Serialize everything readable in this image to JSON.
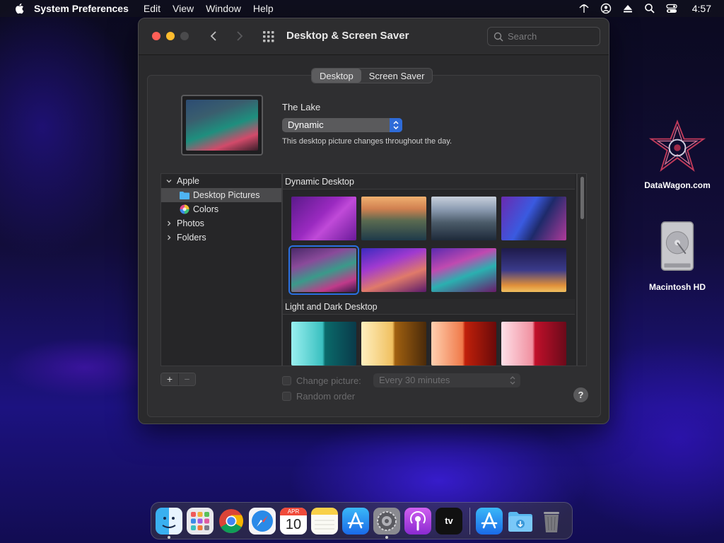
{
  "menubar": {
    "app_name": "System Preferences",
    "items": [
      "Edit",
      "View",
      "Window",
      "Help"
    ],
    "clock": "4:57"
  },
  "desktop_icons": [
    {
      "label": "DataWagon.com"
    },
    {
      "label": "Macintosh HD"
    }
  ],
  "window": {
    "title": "Desktop & Screen Saver",
    "search_placeholder": "Search",
    "tabs": [
      {
        "label": "Desktop",
        "active": true
      },
      {
        "label": "Screen Saver",
        "active": false
      }
    ],
    "picture_name": "The Lake",
    "mode": "Dynamic",
    "description": "This desktop picture changes throughout the day."
  },
  "sidebar": {
    "groups": [
      {
        "label": "Apple",
        "expanded": true
      },
      {
        "label": "Desktop Pictures",
        "selected": true
      },
      {
        "label": "Colors"
      },
      {
        "label": "Photos",
        "expanded": false
      },
      {
        "label": "Folders",
        "expanded": false
      }
    ]
  },
  "sections": [
    {
      "title": "Dynamic Desktop"
    },
    {
      "title": "Light and Dark Desktop"
    }
  ],
  "options": {
    "add_label": "+",
    "remove_label": "−",
    "change_picture_label": "Change picture:",
    "interval_value": "Every 30 minutes",
    "random_order_label": "Random order",
    "help_label": "?"
  },
  "dock": [
    "finder-icon",
    "launchpad-icon",
    "chrome-icon",
    "safari-icon",
    "calendar-icon",
    "notes-icon",
    "app-store-icon",
    "system-preferences-icon",
    "podcasts-icon",
    "apple-tv-icon",
    "app-store-icon",
    "downloads-folder-icon",
    "trash-icon"
  ],
  "calendar": {
    "month": "APR",
    "day": "10"
  },
  "apple_tv_label": "tv",
  "colors": {
    "accent": "#2e6bd8",
    "close": "#ff5f57",
    "minimize": "#febc2e"
  }
}
